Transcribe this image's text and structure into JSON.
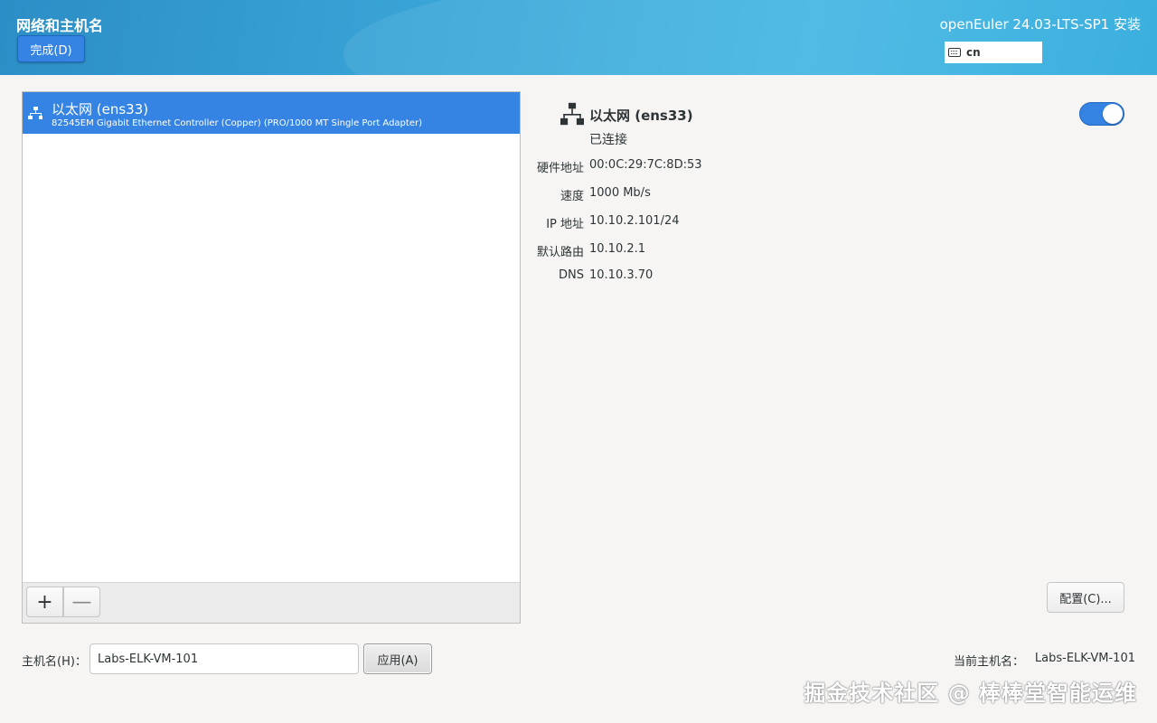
{
  "header": {
    "title": "网络和主机名",
    "done_label": "完成(D)",
    "product": "openEuler 24.03-LTS-SP1 安装",
    "keyboard_layout": "cn",
    "keyboard_icon": "keyboard-icon"
  },
  "devices": [
    {
      "name": "以太网 (ens33)",
      "description": "82545EM Gigabit Ethernet Controller (Copper) (PRO/1000 MT Single Port Adapter)",
      "icon": "wired-network-icon",
      "selected": true
    }
  ],
  "list_toolbar": {
    "add_label": "+",
    "remove_label": "—"
  },
  "details": {
    "title": "以太网 (ens33)",
    "status": "已连接",
    "enabled": true,
    "properties": [
      {
        "label": "硬件地址",
        "value": "00:0C:29:7C:8D:53"
      },
      {
        "label": "速度",
        "value": "1000 Mb/s"
      },
      {
        "label": "IP 地址",
        "value": "10.10.2.101/24"
      },
      {
        "label": "默认路由",
        "value": "10.10.2.1"
      },
      {
        "label": "DNS",
        "value": "10.10.3.70"
      }
    ],
    "configure_label": "配置(C)..."
  },
  "hostname": {
    "label": "主机名(H)：",
    "value": "Labs-ELK-VM-101",
    "apply_label": "应用(A)",
    "current_label": "当前主机名：",
    "current_value": "Labs-ELK-VM-101"
  },
  "watermark": "掘金技术社区 @ 棒棒堂智能运维",
  "colors": {
    "accent": "#3584e4",
    "header_start": "#2c8ec6",
    "header_end": "#43b6e3"
  }
}
